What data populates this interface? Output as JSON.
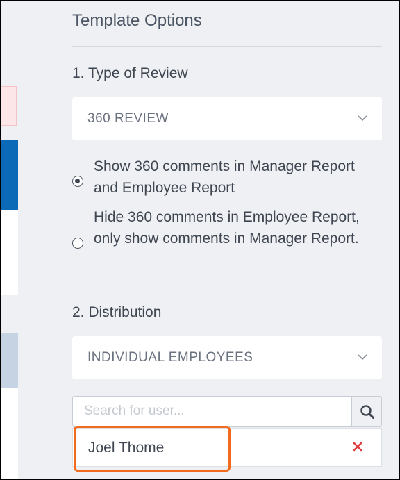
{
  "panel": {
    "title": "Template Options"
  },
  "review_type": {
    "heading": "1.  Type of Review",
    "selected": "360 REVIEW",
    "options": [
      {
        "label": "Show 360 comments in Manager Report and Employee Report",
        "checked": true
      },
      {
        "label": "Hide 360 comments in Employee Report, only show comments in Manager Report.",
        "checked": false
      }
    ]
  },
  "distribution": {
    "heading": "2.  Distribution",
    "selected": "INDIVIDUAL EMPLOYEES",
    "search": {
      "placeholder": "Search for user..."
    },
    "users": [
      {
        "name": "Joel Thome"
      }
    ]
  },
  "colors": {
    "highlight": "#f26a1b",
    "remove_icon": "#e0393e",
    "sidebar_blue": "#0a6ab8"
  },
  "icons": [
    "chevron-down-icon",
    "search-icon",
    "close-icon"
  ]
}
